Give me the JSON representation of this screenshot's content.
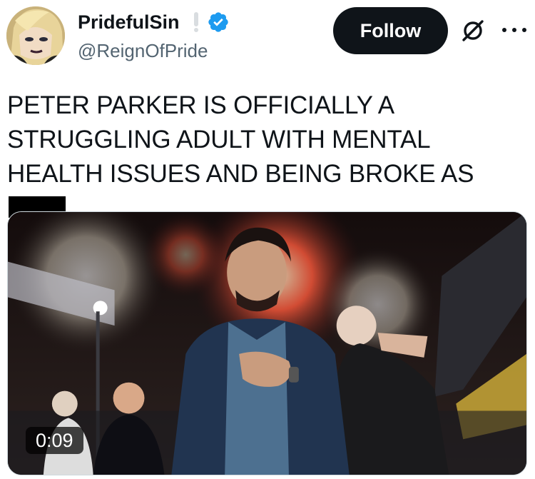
{
  "tweet": {
    "display_name": "PridefulSin",
    "handle": "@ReignOfPride",
    "follow_label": "Follow",
    "text": "PETER PARKER IS OFFICIALLY A STRUGGLING ADULT WITH MENTAL HEALTH ISSUES AND BEING BROKE AS",
    "media": {
      "duration": "0:09"
    }
  },
  "icons": {
    "verified": "verified-badge-icon",
    "grok": "grok-icon",
    "more": "more-icon",
    "status": "exclamation-icon"
  },
  "colors": {
    "verified_blue": "#1d9bf0",
    "follow_bg": "#0f1419",
    "handle_gray": "#536471"
  }
}
